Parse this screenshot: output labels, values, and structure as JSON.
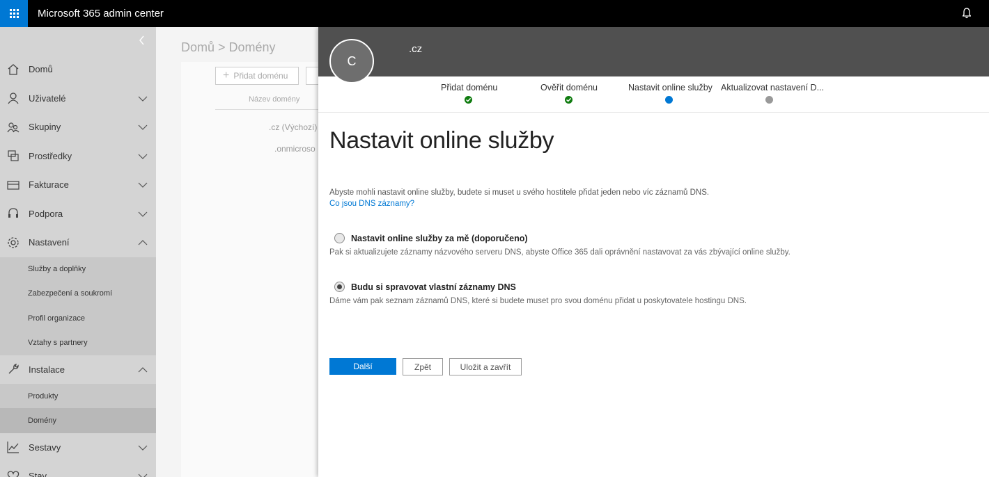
{
  "app": {
    "title": "Microsoft 365 admin center"
  },
  "icons": {
    "waffle": "app-launcher-icon",
    "bell": "notification-bell-icon",
    "collapse": "chevron-left-icon"
  },
  "sidebar": {
    "items": [
      {
        "label": "Domů",
        "icon": "home-icon"
      },
      {
        "label": "Uživatelé",
        "icon": "user-icon"
      },
      {
        "label": "Skupiny",
        "icon": "group-icon"
      },
      {
        "label": "Prostředky",
        "icon": "resources-icon"
      },
      {
        "label": "Fakturace",
        "icon": "billing-icon"
      },
      {
        "label": "Podpora",
        "icon": "headset-icon"
      },
      {
        "label": "Nastavení",
        "icon": "gear-icon"
      }
    ],
    "settings_sub": [
      {
        "label": "Služby a doplňky"
      },
      {
        "label": "Zabezpečení a soukromí"
      },
      {
        "label": "Profil organizace"
      },
      {
        "label": "Vztahy s partnery"
      }
    ],
    "install": {
      "label": "Instalace",
      "icon": "wrench-icon"
    },
    "install_sub": [
      {
        "label": "Produkty"
      },
      {
        "label": "Domény"
      }
    ],
    "reports": {
      "label": "Sestavy",
      "icon": "chart-icon"
    },
    "health": {
      "label": "Stav",
      "icon": "heart-icon"
    }
  },
  "background": {
    "breadcrumb": "Domů > Domény",
    "add_domain": "Přidat doménu",
    "column_header": "Název domény",
    "row1": ".cz (Výchozí)",
    "row2": ".onmicroso"
  },
  "panel": {
    "avatar_letter": "C",
    "domain": ".cz",
    "steps": [
      {
        "label": "Přidat doménu",
        "state": "done"
      },
      {
        "label": "Ověřit doménu",
        "state": "done"
      },
      {
        "label": "Nastavit online služby",
        "state": "current"
      },
      {
        "label": "Aktualizovat nastavení D...",
        "state": "pending"
      }
    ],
    "colors": {
      "done": "#107c10",
      "current": "#0078d4",
      "pending": "#999999"
    },
    "heading": "Nastavit online služby",
    "intro": "Abyste mohli nastavit online služby, budete si muset u svého hostitele přidat jeden nebo víc záznamů DNS.",
    "intro_link": "Co jsou DNS záznamy?",
    "options": [
      {
        "label": "Nastavit online služby za mě (doporučeno)",
        "description": "Pak si aktualizujete záznamy názvového serveru DNS, abyste Office 365 dali oprávnění nastavovat za vás zbývající online služby.",
        "checked": false
      },
      {
        "label": "Budu si spravovat vlastní záznamy DNS",
        "description": "Dáme vám pak seznam záznamů DNS, které si budete muset pro svou doménu přidat u poskytovatele hostingu DNS.",
        "checked": true
      }
    ],
    "buttons": {
      "next": "Další",
      "back": "Zpět",
      "save_close": "Uložit a zavřít"
    }
  }
}
